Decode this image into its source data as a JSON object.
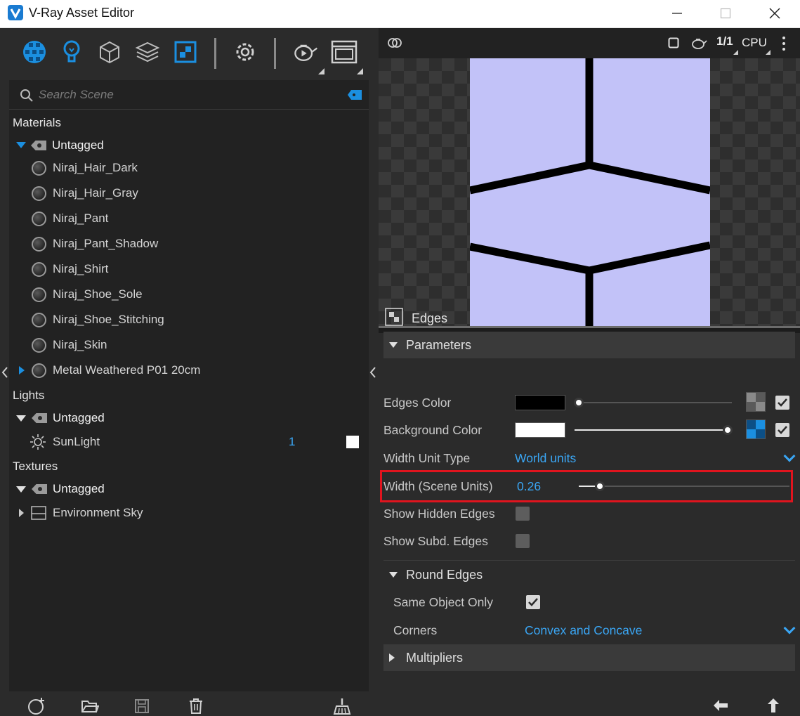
{
  "window": {
    "title": "V-Ray Asset Editor",
    "minimize_icon": "minimize-icon",
    "maximize_icon": "maximize-icon",
    "close_icon": "close-icon"
  },
  "toolbar": {
    "items": [
      "materials-icon",
      "lights-icon",
      "geometry-icon",
      "render-elements-icon",
      "textures-icon",
      "settings-icon",
      "render-teapot-icon",
      "frame-buffer-icon"
    ]
  },
  "search": {
    "placeholder": "Search Scene"
  },
  "tree": {
    "materials_label": "Materials",
    "materials_group": "Untagged",
    "materials": [
      "Niraj_Hair_Dark",
      "Niraj_Hair_Gray",
      "Niraj_Pant",
      "Niraj_Pant_Shadow",
      "Niraj_Shirt",
      "Niraj_Shoe_Sole",
      "Niraj_Shoe_Stitching",
      "Niraj_Skin",
      "Metal Weathered P01 20cm"
    ],
    "lights_label": "Lights",
    "lights_group": "Untagged",
    "lights": [
      {
        "name": "SunLight",
        "count": "1"
      }
    ],
    "textures_label": "Textures",
    "textures_group": "Untagged",
    "textures": [
      "Environment Sky"
    ]
  },
  "preview_toolbar": {
    "ratio": "1/1",
    "engine": "CPU"
  },
  "editor": {
    "title": "Edges",
    "parameters_label": "Parameters",
    "edges_color_label": "Edges Color",
    "edges_color": "#000000",
    "background_color_label": "Background Color",
    "background_color": "#ffffff",
    "width_unit_type_label": "Width Unit Type",
    "width_unit_type_value": "World units",
    "width_label": "Width (Scene Units)",
    "width_value": "0.26",
    "width_slider_fraction": 0.1,
    "edges_color_slider_fraction": 0.0,
    "background_slider_fraction": 1.0,
    "show_hidden_edges_label": "Show Hidden Edges",
    "show_hidden_edges": false,
    "show_subd_edges_label": "Show Subd. Edges",
    "show_subd_edges": false,
    "round_edges_label": "Round Edges",
    "same_object_only_label": "Same Object Only",
    "same_object_only": true,
    "corners_label": "Corners",
    "corners_value": "Convex and Concave",
    "multipliers_label": "Multipliers"
  },
  "colors": {
    "accent": "#3aa6f4",
    "highlight": "#e0141e",
    "preview_fill": "#c2c2f8"
  }
}
